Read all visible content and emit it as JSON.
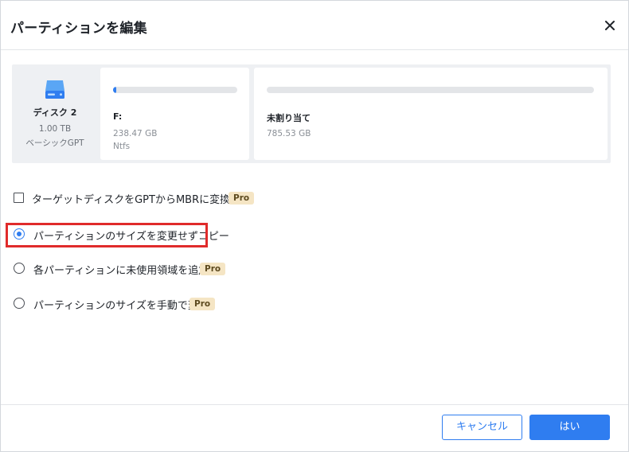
{
  "dialog": {
    "title": "パーティションを編集"
  },
  "disk": {
    "name": "ディスク 2",
    "size": "1.00 TB",
    "type": "ベーシックGPT",
    "icon": "hard-disk-icon"
  },
  "partitions": [
    {
      "label": "F:",
      "size": "238.47 GB",
      "fs": "Ntfs",
      "usage_fraction": 0.02
    },
    {
      "label": "未割り当て",
      "size": "785.53 GB",
      "fs": "",
      "usage_fraction": 0
    }
  ],
  "options": [
    {
      "label": "ターゲットディスクをGPTからMBRに変換する",
      "control": "checkbox",
      "checked": false,
      "pro": "Pro"
    },
    {
      "label": "パーティションのサイズを変更せずコピー",
      "control": "radio",
      "checked": true,
      "pro": ""
    },
    {
      "label": "各パーティションに未使用領域を追加",
      "control": "radio",
      "checked": false,
      "pro": "Pro"
    },
    {
      "label": "パーティションのサイズを手動で変更",
      "control": "radio",
      "checked": false,
      "pro": "Pro"
    }
  ],
  "footer": {
    "cancel_label": "キャンセル",
    "ok_label": "はい"
  },
  "colors": {
    "accent": "#2f7df0",
    "highlight": "#e02b2b",
    "pro_badge_bg": "#f5e5c4"
  }
}
